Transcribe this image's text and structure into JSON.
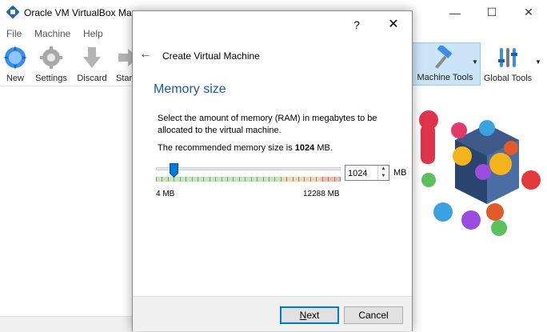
{
  "main_window": {
    "title": "Oracle VM VirtualBox Ma",
    "menu": [
      "File",
      "Machine",
      "Help"
    ],
    "toolbar": {
      "new": "New",
      "settings": "Settings",
      "discard": "Discard",
      "start": "Star",
      "machine_tools": "Machine Tools",
      "global_tools": "Global Tools"
    }
  },
  "dialog": {
    "help_glyph": "?",
    "close_glyph": "✕",
    "back_glyph": "←",
    "title": "Create Virtual Machine",
    "heading": "Memory size",
    "description": "Select the amount of memory (RAM) in megabytes to be allocated to the virtual machine.",
    "recommended_prefix": "The recommended memory size is ",
    "recommended_value": "1024",
    "recommended_suffix": " MB.",
    "memory": {
      "value": "1024",
      "unit": "MB",
      "min_label": "4 MB",
      "max_label": "12288 MB",
      "min_mb": 4,
      "max_mb": 12288,
      "selected_mb": 1024
    },
    "buttons": {
      "next_mnemonic": "N",
      "next_rest": "ext",
      "cancel": "Cancel"
    },
    "colors": {
      "heading": "#1a5aa6",
      "accent": "#0078d7",
      "zone_green": "#c6e8b8",
      "zone_orange": "#f7d6b5",
      "zone_red": "#f4b7b0"
    }
  }
}
